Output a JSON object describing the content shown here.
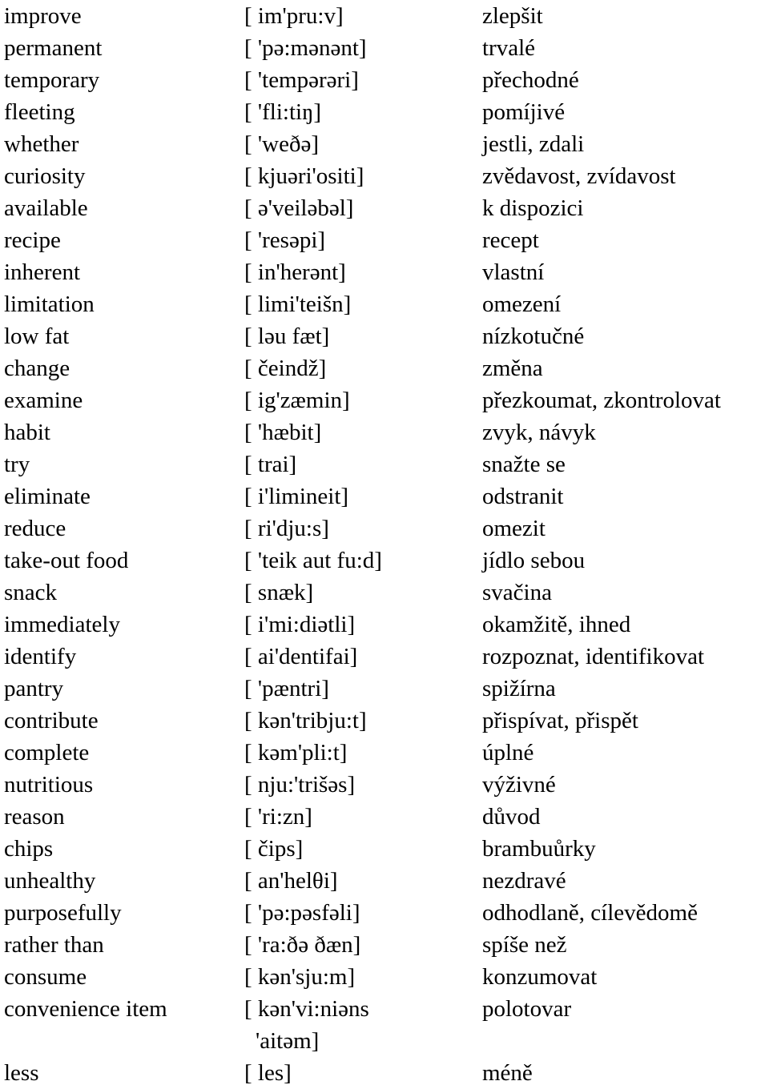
{
  "document": {
    "type": "vocabulary-list",
    "language_pair": "English - Czech",
    "columns": [
      "term",
      "pronunciation",
      "translation"
    ],
    "entries": [
      {
        "term": "improve",
        "ipa": "[ im'pru:v]",
        "cs": "zlepšit"
      },
      {
        "term": "permanent",
        "ipa": "[ 'pə:mənənt]",
        "cs": "trvalé"
      },
      {
        "term": "temporary",
        "ipa": "[ 'tempərəri]",
        "cs": "přechodné"
      },
      {
        "term": "fleeting",
        "ipa": "[ 'fli:tiŋ]",
        "cs": "pomíjivé"
      },
      {
        "term": "whether",
        "ipa": "[ 'weðə]",
        "cs": "jestli, zdali"
      },
      {
        "term": "curiosity",
        "ipa": "[ kjuəri'ositi]",
        "cs": "zvědavost, zvídavost"
      },
      {
        "term": "available",
        "ipa": "[ ə'veiləbəl]",
        "cs": "k dispozici"
      },
      {
        "term": "recipe",
        "ipa": "[ 'resəpi]",
        "cs": "recept"
      },
      {
        "term": "inherent",
        "ipa": "[ in'herənt]",
        "cs": "vlastní"
      },
      {
        "term": "limitation",
        "ipa": "[ limi'teišn]",
        "cs": "omezení"
      },
      {
        "term": "low fat",
        "ipa": "[ ləu fæt]",
        "cs": "nízkotučné"
      },
      {
        "term": "change",
        "ipa": "[ čeindž]",
        "cs": "změna"
      },
      {
        "term": "examine",
        "ipa": "[ ig'zæmin]",
        "cs": "přezkoumat, zkontrolovat"
      },
      {
        "term": "habit",
        "ipa": "[ 'hæbit]",
        "cs": "zvyk, návyk"
      },
      {
        "term": "try",
        "ipa": "[ trai]",
        "cs": "snažte se"
      },
      {
        "term": "eliminate",
        "ipa": "[ i'limineit]",
        "cs": "odstranit"
      },
      {
        "term": "reduce",
        "ipa": "[ ri'dju:s]",
        "cs": "omezit"
      },
      {
        "term": "take-out food",
        "ipa": "[ 'teik aut fu:d]",
        "cs": "jídlo sebou"
      },
      {
        "term": "snack",
        "ipa": "[ snæk]",
        "cs": "svačina"
      },
      {
        "term": "immediately",
        "ipa": "[ i'mi:diətli]",
        "cs": "okamžitě, ihned"
      },
      {
        "term": "identify",
        "ipa": "[ ai'dentifai]",
        "cs": "rozpoznat, identifikovat"
      },
      {
        "term": "pantry",
        "ipa": "[ 'pæntri]",
        "cs": "spižírna"
      },
      {
        "term": "contribute",
        "ipa": "[ kən'tribju:t]",
        "cs": "přispívat, přispět"
      },
      {
        "term": "complete",
        "ipa": "[ kəm'pli:t]",
        "cs": "úplné"
      },
      {
        "term": "nutritious",
        "ipa": "[ nju:'trišəs]",
        "cs": "výživné"
      },
      {
        "term": "reason",
        "ipa": "[ 'ri:zn]",
        "cs": "důvod"
      },
      {
        "term": "chips",
        "ipa": "[ čips]",
        "cs": "brambuůrky"
      },
      {
        "term": "unhealthy",
        "ipa": "[ an'helθi]",
        "cs": "nezdravé"
      },
      {
        "term": "purposefully",
        "ipa": "[ 'pə:pəsfəli]",
        "cs": "odhodlaně, cílevědomě"
      },
      {
        "term": "rather than",
        "ipa": "[ 'ra:ðə ðæn]",
        "cs": "spíše než"
      },
      {
        "term": "consume",
        "ipa": "[ kən'sju:m]",
        "cs": "konzumovat"
      },
      {
        "term": "convenience item",
        "ipa": "[ kən'vi:niəns",
        "ipa_cont": "'aitəm]",
        "cs": "polotovar"
      },
      {
        "term": "less",
        "ipa": "[ les]",
        "cs": "méně"
      }
    ]
  }
}
